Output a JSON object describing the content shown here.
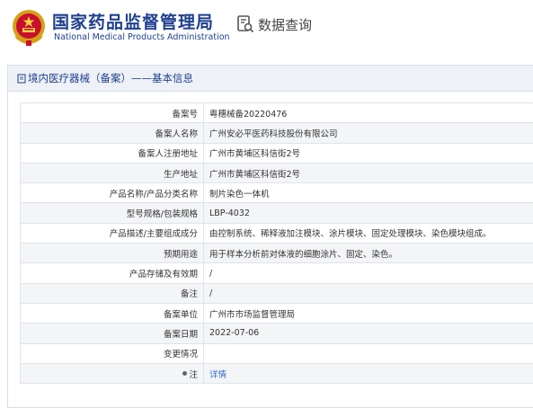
{
  "header": {
    "org_name_cn": "国家药品监督管理局",
    "org_name_en": "National Medical Products Administration",
    "search_label": "数据查询",
    "brand_color": "#1f3f8f"
  },
  "panel": {
    "title": "境内医疗器械（备案）——基本信息"
  },
  "rows": [
    {
      "label": "备案号",
      "value": "粤穗械备20220476"
    },
    {
      "label": "备案人名称",
      "value": "广州安必平医药科技股份有限公司"
    },
    {
      "label": "备案人注册地址",
      "value": "广州市黄埔区科信街2号"
    },
    {
      "label": "生产地址",
      "value": "广州市黄埔区科信街2号"
    },
    {
      "label": "产品名称/产品分类名称",
      "value": "制片染色一体机"
    },
    {
      "label": "型号规格/包装规格",
      "value": "LBP-4032"
    },
    {
      "label": "产品描述/主要组成成分",
      "value": "由控制系统、稀释液加注模块、涂片模块、固定处理模块、染色模块组成。"
    },
    {
      "label": "预期用途",
      "value": "用于样本分析前对体液的细胞涂片、固定、染色。"
    },
    {
      "label": "产品存储及有效期",
      "value": "/"
    },
    {
      "label": "备注",
      "value": "/"
    },
    {
      "label": "备案单位",
      "value": "广州市市场监督管理局"
    },
    {
      "label": "备案日期",
      "value": "2022-07-06"
    },
    {
      "label": "变更情况",
      "value": ""
    },
    {
      "label": "注",
      "value": "详情"
    }
  ]
}
